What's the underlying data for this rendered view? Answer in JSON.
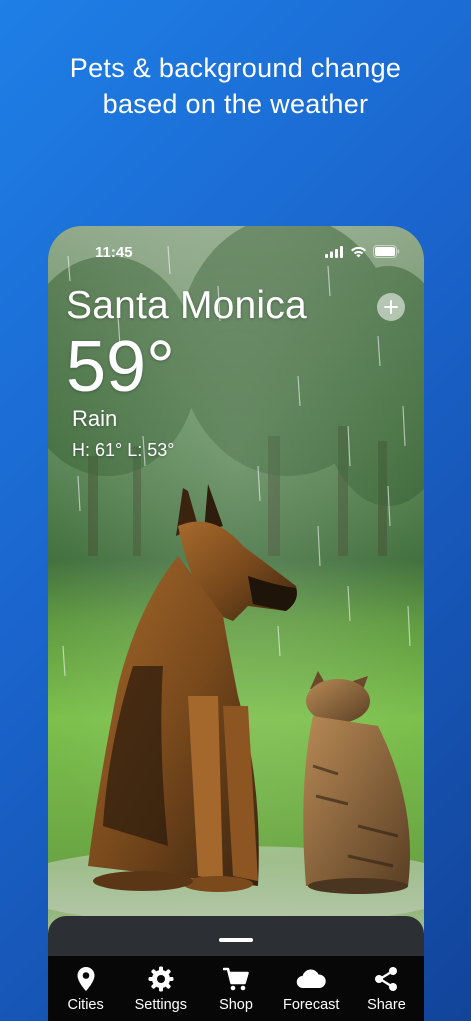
{
  "headline": {
    "line1": "Pets & background change",
    "line2": "based on the weather"
  },
  "status_bar": {
    "time": "11:45"
  },
  "weather": {
    "city": "Santa Monica",
    "temperature": "59°",
    "condition": "Rain",
    "high_low": "H: 61° L: 53°"
  },
  "tabs": [
    {
      "label": "Cities",
      "icon": "location-pin-icon"
    },
    {
      "label": "Settings",
      "icon": "gear-icon"
    },
    {
      "label": "Shop",
      "icon": "cart-icon"
    },
    {
      "label": "Forecast",
      "icon": "cloud-icon"
    },
    {
      "label": "Share",
      "icon": "share-icon"
    }
  ],
  "colors": {
    "background_top": "#1e7fe6",
    "background_bottom": "#12449a",
    "tab_bar": "#070707",
    "sheet": "#2c2f33"
  }
}
